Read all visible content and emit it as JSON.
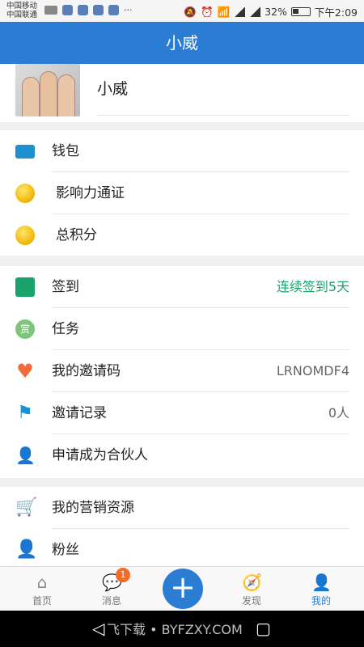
{
  "statusbar": {
    "carrier1": "中国移动",
    "carrier2": "中国联通",
    "more": "···",
    "net": "2G 4G",
    "battery": "32%",
    "time": "下午2:09"
  },
  "header": {
    "title": "小威"
  },
  "profile": {
    "name": "小威"
  },
  "group1": [
    {
      "label": "钱包",
      "icon": "wallet-icon"
    },
    {
      "label": "影响力通证",
      "icon": "coin-icon"
    },
    {
      "label": "总积分",
      "icon": "star-coin-icon"
    }
  ],
  "group2": [
    {
      "label": "签到",
      "value": "连续签到5天",
      "icon": "calendar-check-icon"
    },
    {
      "label": "任务",
      "value": "",
      "icon": "reward-icon",
      "icon_text": "赏"
    },
    {
      "label": "我的邀请码",
      "value": "LRNOMDF4",
      "icon": "heart-icon"
    },
    {
      "label": "邀请记录",
      "value": "0人",
      "icon": "flag-icon"
    },
    {
      "label": "申请成为合伙人",
      "value": "",
      "icon": "add-user-icon"
    }
  ],
  "group3": [
    {
      "label": "我的营销资源",
      "icon": "cart-icon"
    },
    {
      "label": "粉丝",
      "icon": "fans-icon"
    }
  ],
  "tabs": [
    {
      "label": "首页",
      "icon": "home-icon"
    },
    {
      "label": "消息",
      "icon": "message-icon",
      "badge": "1"
    },
    {
      "label": "发现",
      "icon": "compass-icon"
    },
    {
      "label": "我的",
      "icon": "profile-icon",
      "active": true
    }
  ],
  "watermark": "飞下载 • BYFZXY.COM",
  "colors": {
    "primary": "#2b7cd3",
    "green": "#1aa26b",
    "badge": "#f06a2a"
  }
}
